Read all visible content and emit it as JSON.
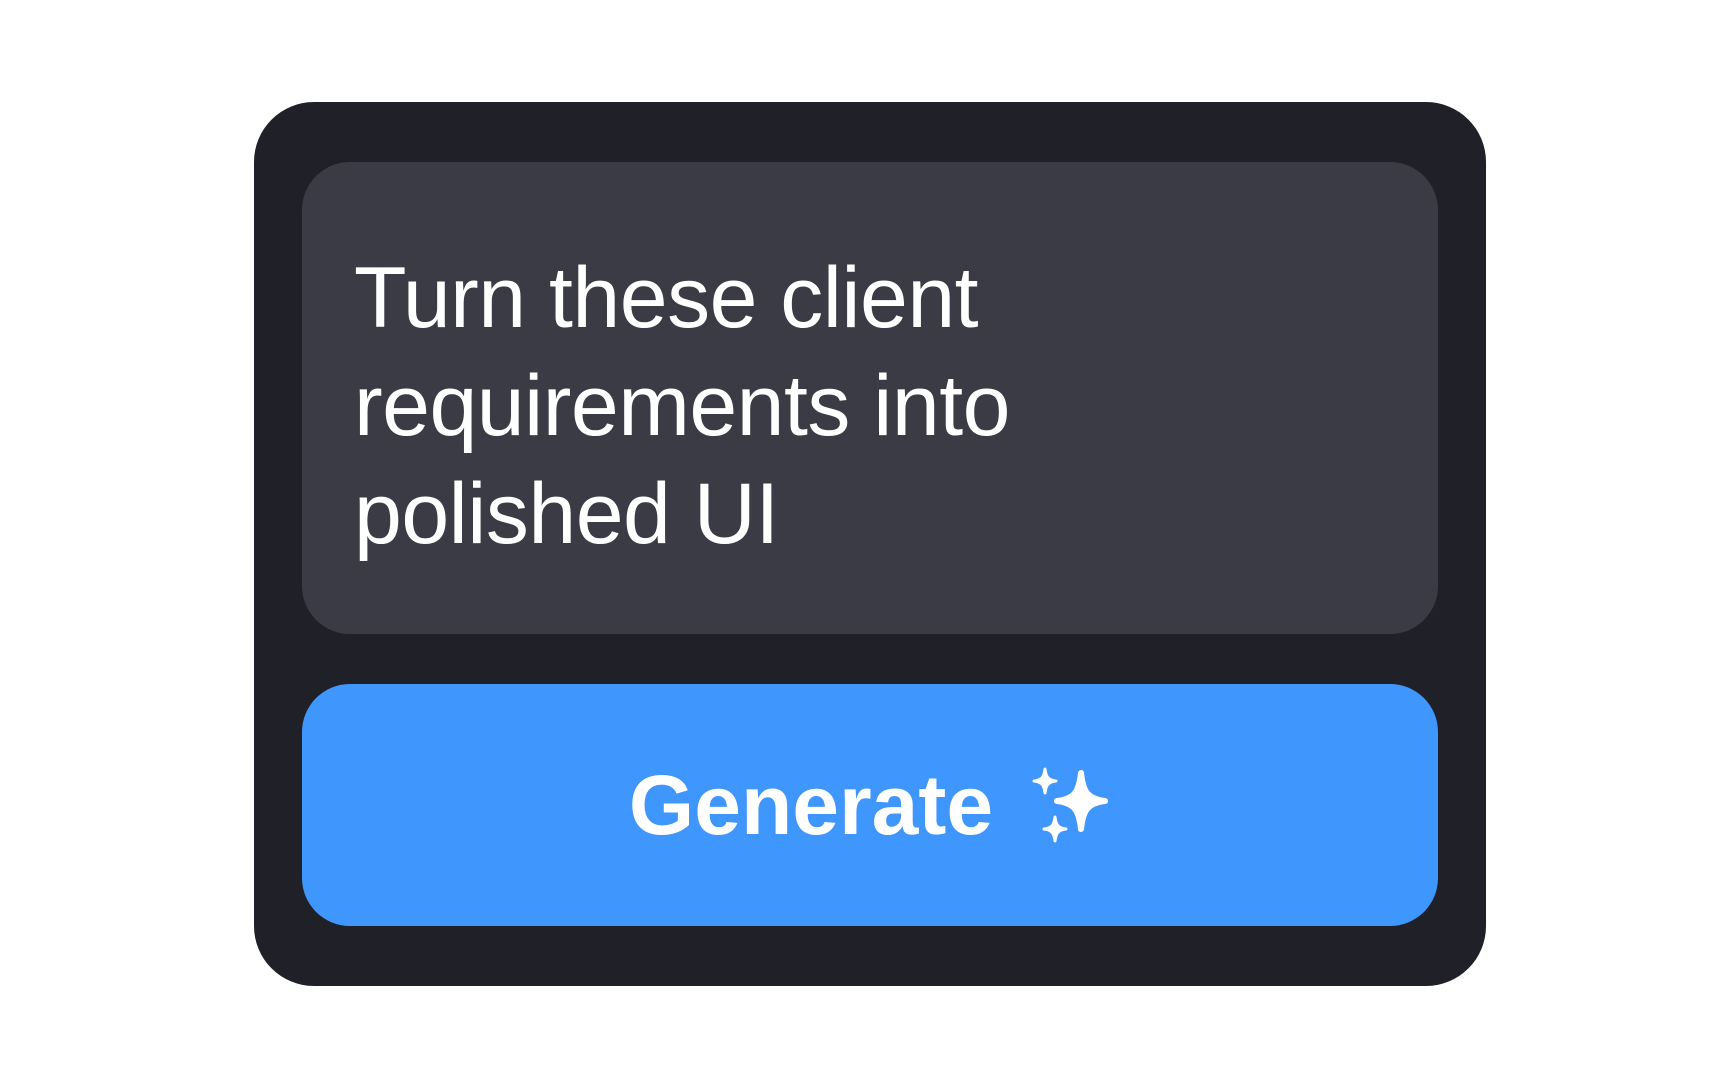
{
  "prompt": {
    "text": "Turn these client requirements into polished UI"
  },
  "action": {
    "label": "Generate",
    "icon": "sparkles-icon"
  },
  "colors": {
    "page_background": "#ffffff",
    "card_background": "#202128",
    "prompt_background": "#3a3b44",
    "button_background": "#3f96fc",
    "text": "#ffffff"
  }
}
